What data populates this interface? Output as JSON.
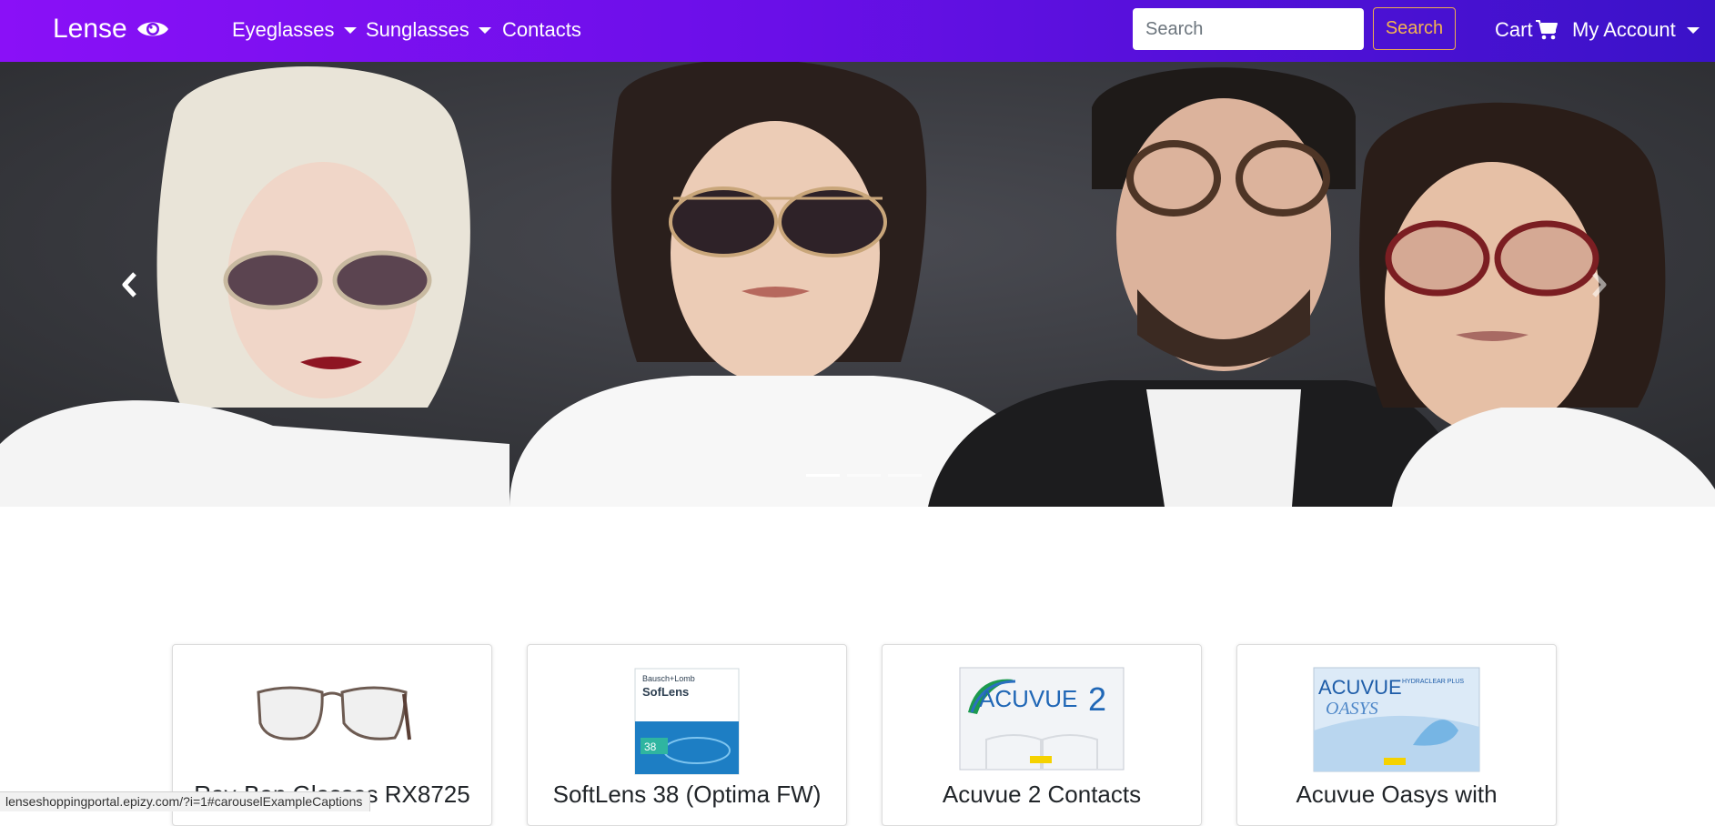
{
  "navbar": {
    "brand": "Lense",
    "brand_icon": "eye-icon",
    "menu": [
      {
        "label": "Eyeglasses",
        "dropdown": true
      },
      {
        "label": "Sunglasses",
        "dropdown": true
      },
      {
        "label": "Contacts",
        "dropdown": false
      }
    ],
    "search": {
      "placeholder": "Search",
      "value": "",
      "button_label": "Search"
    },
    "cart_label": "Cart",
    "account_label": "My Account",
    "colors": {
      "gradient_start": "#8a10f7",
      "gradient_end": "#3a12c8",
      "search_button": "#f5b54e"
    }
  },
  "carousel": {
    "active_index": 0,
    "slide_count": 3
  },
  "products": [
    {
      "title": "Ray-Ban Glasses RX8725"
    },
    {
      "title": "SoftLens 38 (Optima FW)"
    },
    {
      "title": "Acuvue 2 Contacts"
    },
    {
      "title": "Acuvue Oasys with"
    }
  ],
  "product_images": {
    "softlens_brand": "Bausch+Lomb",
    "softlens_name": "SofLens",
    "softlens_number": "38",
    "acuvue2_name": "ACUVUE",
    "acuvue2_number": "2",
    "oasys_name": "ACUVUE",
    "oasys_sub": "OASYS",
    "oasys_tag": "HYDRACLEAR PLUS"
  },
  "status_bar": {
    "url": "lenseshoppingportal.epizy.com/?i=1#carouselExampleCaptions"
  }
}
